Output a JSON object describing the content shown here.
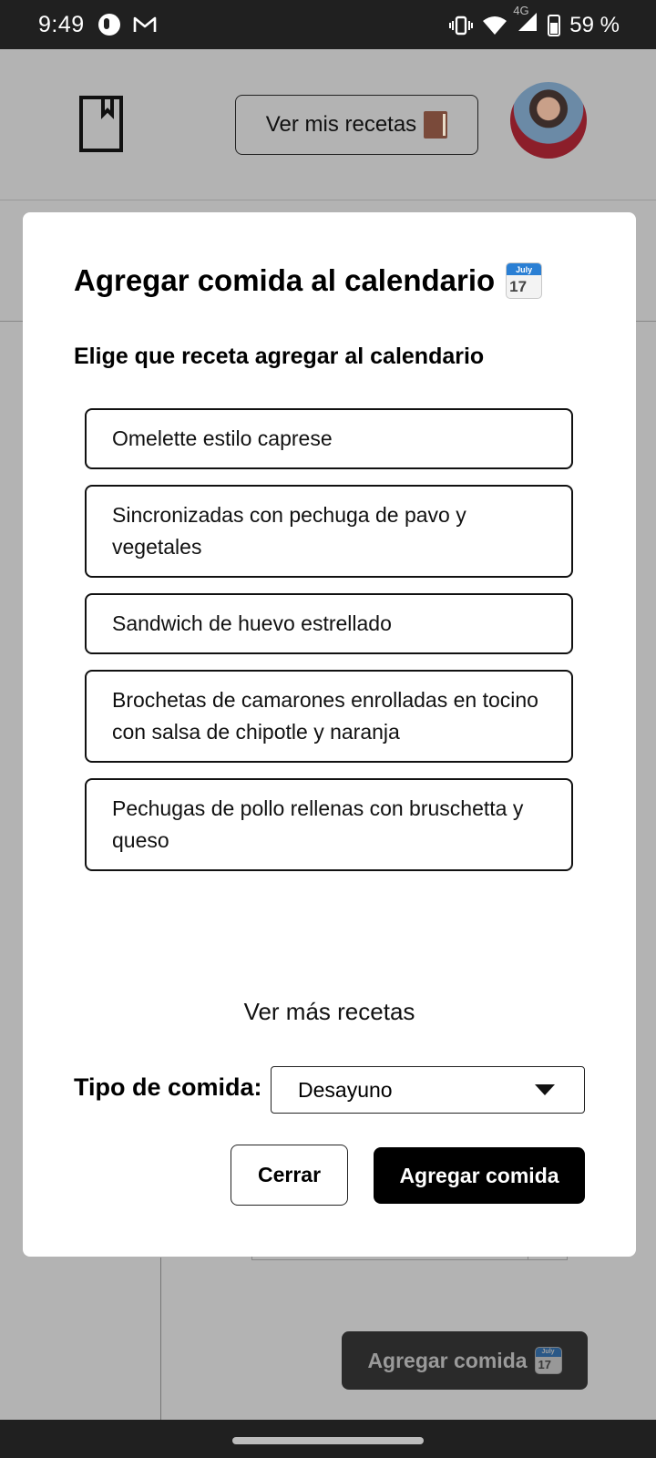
{
  "status_bar": {
    "time": "9:49",
    "network": "4G",
    "battery": "59 %",
    "icons": [
      "app-notification-icon",
      "gmail-icon",
      "vibrate-icon",
      "wifi-icon",
      "signal-icon",
      "battery-charging-icon"
    ]
  },
  "header": {
    "recetas_button_label": "Ver mis recetas",
    "recetas_button_icon": "book-icon"
  },
  "modal": {
    "title": "Agregar comida al calendario",
    "calendar_month": "July",
    "calendar_day": "17",
    "subtitle": "Elige que receta agregar al calendario",
    "recipes": [
      "Omelette estilo caprese",
      "Sincronizadas con pechuga de pavo y vegetales",
      "Sandwich de huevo estrellado",
      "Brochetas de camarones enrolladas en tocino con salsa de chipotle y naranja",
      "Pechugas de pollo rellenas con bruschetta y queso"
    ],
    "more_recipes_label": "Ver más recetas",
    "meal_type_label": "Tipo de comida:",
    "meal_type_value": "Desayuno",
    "close_label": "Cerrar",
    "add_label": "Agregar comida"
  },
  "background": {
    "add_button_label": "Agregar comida"
  },
  "colors": {
    "overlay": "#b3b3b3",
    "primary_button": "#000000",
    "status_bar": "#202020"
  }
}
